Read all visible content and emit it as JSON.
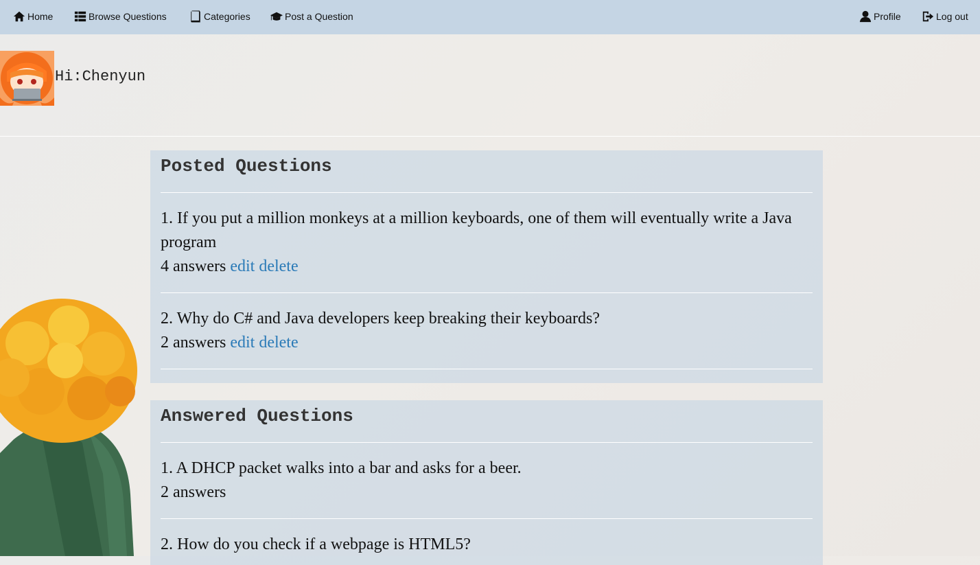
{
  "nav": {
    "home": "Home",
    "browse": "Browse Questions",
    "categories": "Categories",
    "post": "Post a Question",
    "profile": "Profile",
    "logout": "Log out"
  },
  "header": {
    "greeting": "Hi:Chenyun"
  },
  "posted": {
    "title": "Posted Questions",
    "edit_label": "edit",
    "delete_label": "delete",
    "items": [
      {
        "text": "1. If you put a million monkeys at a million keyboards, one of them will eventually write a Java program",
        "answers": "4 answers"
      },
      {
        "text": "2. Why do C# and Java developers keep breaking their keyboards?",
        "answers": "2 answers"
      }
    ]
  },
  "answered": {
    "title": "Answered Questions",
    "items": [
      {
        "text": "1. A DHCP packet walks into a bar and asks for a beer.",
        "answers": "2 answers"
      },
      {
        "text": "2. How do you check if a webpage is HTML5?"
      }
    ]
  },
  "colors": {
    "navbar": "#c5d5e4",
    "link": "#2a7ab7",
    "panel": "#cfdbe6"
  }
}
